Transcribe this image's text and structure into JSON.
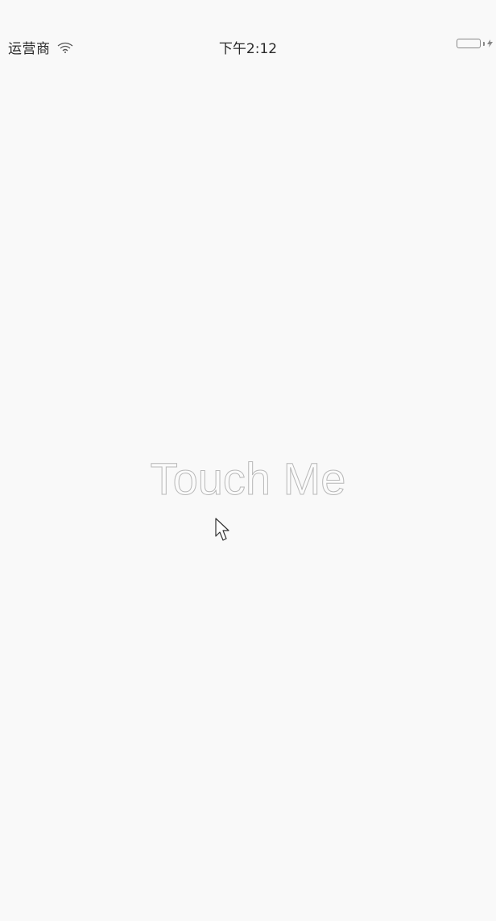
{
  "status_bar": {
    "carrier": "运营商",
    "time": "下午2:12",
    "wifi_icon": "wifi-icon",
    "battery_icon": "battery-icon",
    "charging_icon": "bolt-icon"
  },
  "main": {
    "touch_label": "Touch Me",
    "pointer_icon": "cursor-arrow-icon"
  },
  "colors": {
    "background": "#f9f9f9",
    "status_text": "#2a2a2a",
    "label_outline": "#b8b8b8"
  }
}
